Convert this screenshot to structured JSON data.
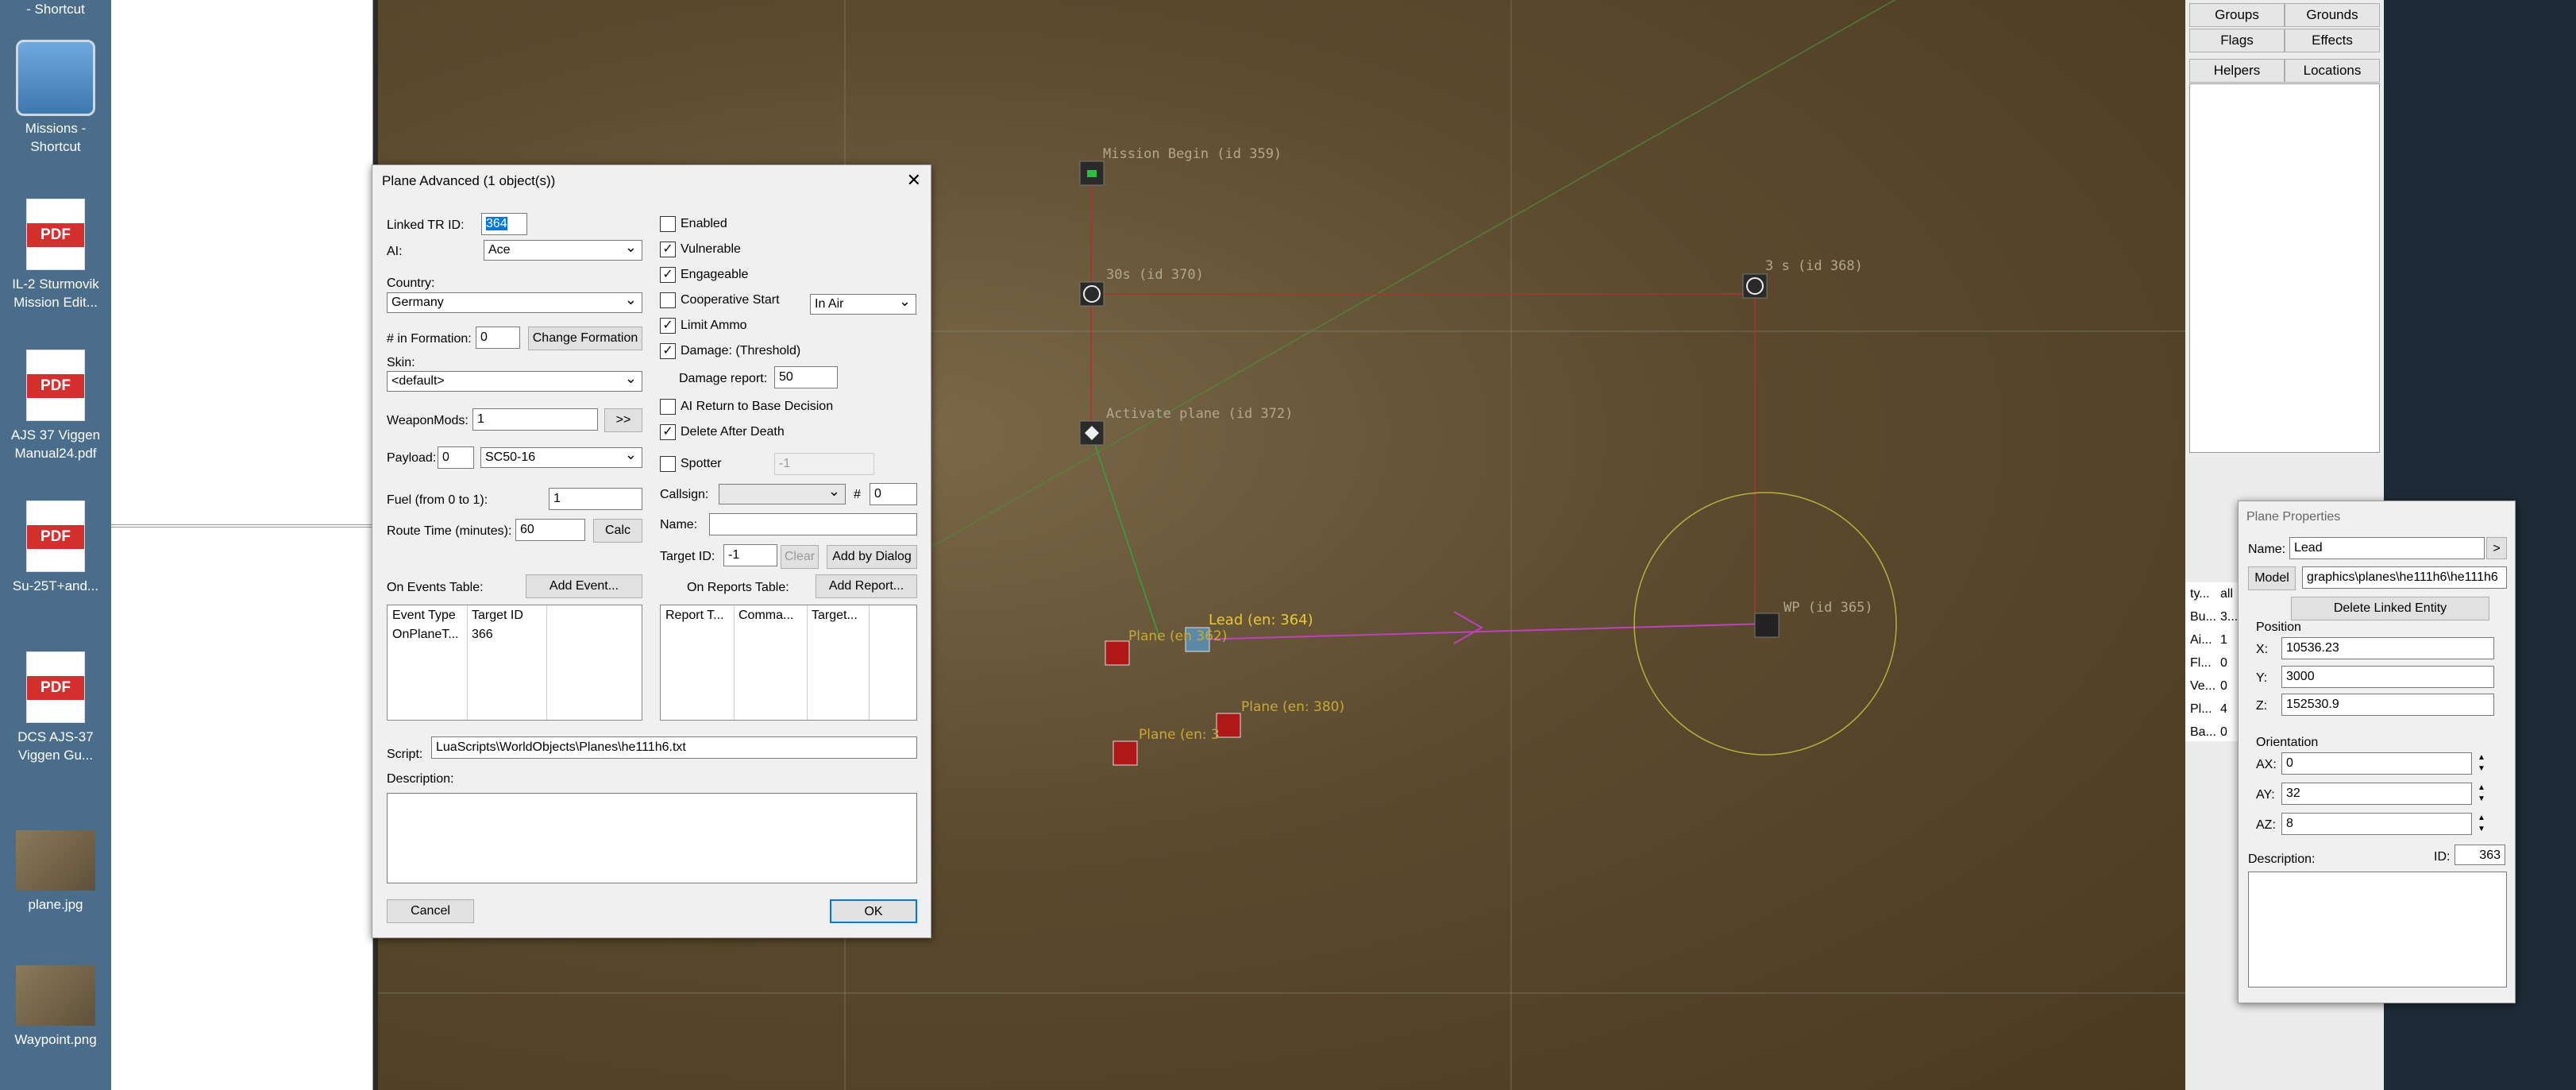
{
  "desktop": {
    "items": [
      {
        "label": "- Shortcut"
      },
      {
        "label": "Missions - Shortcut"
      },
      {
        "label": "IL-2 Sturmovik Mission Edit..."
      },
      {
        "label": "AJS 37 Viggen Manual24.pdf"
      },
      {
        "label": "Su-25T+and..."
      },
      {
        "label": "DCS AJS-37 Viggen Gu..."
      },
      {
        "label": "plane.jpg"
      },
      {
        "label": "Waypoint.png"
      }
    ],
    "pdf_badge": "PDF"
  },
  "map": {
    "labels": {
      "mission_begin": "Mission Begin (id 359)",
      "timer1": "30s (id 370)",
      "timer2": "3 s (id 368)",
      "activate": "Activate plane (id 372)",
      "lead": "Lead (en: 364)",
      "plane1": "Plane (en 362)",
      "plane2": "Plane (en: 380)",
      "plane3": "Plane (en: 3",
      "waypoint": "WP (id 365)"
    }
  },
  "right_panel": {
    "buttons": {
      "groups": "Groups",
      "grounds": "Grounds",
      "flags": "Flags",
      "effects": "Effects",
      "helpers": "Helpers",
      "locations": "Locations"
    },
    "table": [
      "ty...",
      "Bu...",
      "Ai...",
      "Fl...",
      "Ve...",
      "Pl...",
      "Ba..."
    ],
    "table_vals": [
      "all",
      "3...",
      "1",
      "0",
      "0",
      "4",
      "0"
    ]
  },
  "plane_advanced": {
    "title": "Plane Advanced (1 object(s))",
    "linked_tr_label": "Linked TR ID:",
    "linked_tr_value": "364",
    "ai_label": "AI:",
    "ai_value": "Ace",
    "country_label": "Country:",
    "country_value": "Germany",
    "formation_label": "# in Formation:",
    "formation_value": "0",
    "change_formation": "Change Formation",
    "skin_label": "Skin:",
    "skin_value": "<default>",
    "weaponmods_label": "WeaponMods:",
    "weaponmods_value": "1",
    "weaponmods_btn": ">>",
    "payload_label": "Payload:",
    "payload_value": "0",
    "payload_select": "SC50-16",
    "fuel_label": "Fuel (from 0 to 1):",
    "fuel_value": "1",
    "route_label": "Route Time (minutes):",
    "route_value": "60",
    "calc": "Calc",
    "events_label": "On Events Table:",
    "add_event": "Add Event...",
    "events_cols": [
      "Event Type",
      "Target ID"
    ],
    "events_rows": [
      [
        "OnPlaneT...",
        "366"
      ]
    ],
    "reports_label": "On Reports Table:",
    "add_report": "Add Report...",
    "reports_cols": [
      "Report T...",
      "Comma...",
      "Target..."
    ],
    "enabled": "Enabled",
    "vulnerable": "Vulnerable",
    "engageable": "Engageable",
    "coop_start": "Cooperative Start",
    "coop_select": "In Air",
    "limit_ammo": "Limit Ammo",
    "damage_threshold": "Damage: (Threshold)",
    "damage_report_label": "Damage report:",
    "damage_report_value": "50",
    "ai_return": "AI Return to Base Decision",
    "delete_after": "Delete After Death",
    "spotter": "Spotter",
    "spotter_value": "-1",
    "callsign_label": "Callsign:",
    "callsign_hash": "#",
    "callsign_num": "0",
    "name_label": "Name:",
    "name_value": "",
    "target_id_label": "Target ID:",
    "target_id_value": "-1",
    "clear": "Clear",
    "add_by_dialog": "Add by Dialog",
    "script_label": "Script:",
    "script_value": "LuaScripts\\WorldObjects\\Planes\\he111h6.txt",
    "description_label": "Description:",
    "cancel": "Cancel",
    "ok": "OK",
    "checks": {
      "enabled": false,
      "vulnerable": true,
      "engageable": true,
      "coop": false,
      "limit_ammo": true,
      "damage": true,
      "ai_return": false,
      "delete_after": true,
      "spotter": false
    }
  },
  "plane_properties": {
    "title": "Plane Properties",
    "name_label": "Name:",
    "name_value": "Lead",
    "name_btn": ">",
    "model_btn": "Model",
    "model_value": "graphics\\planes\\he111h6\\he111h6",
    "delete_linked": "Delete Linked Entity",
    "position_label": "Position",
    "x_label": "X:",
    "x_value": "10536.23",
    "y_label": "Y:",
    "y_value": "3000",
    "z_label": "Z:",
    "z_value": "152530.9",
    "orientation_label": "Orientation",
    "ax_label": "AX:",
    "ax_value": "0",
    "ay_label": "AY:",
    "ay_value": "32",
    "az_label": "AZ:",
    "az_value": "8",
    "description_label": "Description:",
    "id_label": "ID:",
    "id_value": "363"
  }
}
